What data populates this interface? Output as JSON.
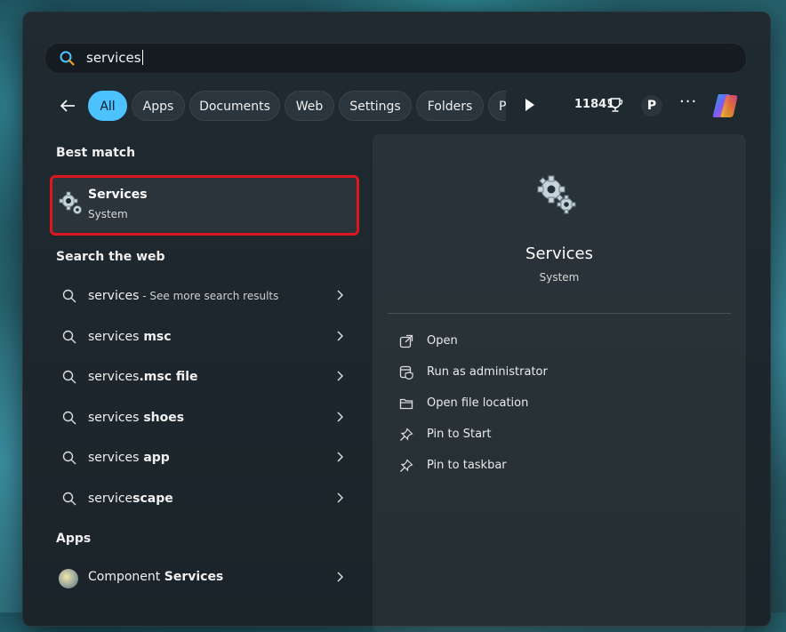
{
  "search": {
    "query": "services"
  },
  "filters": {
    "chips": [
      "All",
      "Apps",
      "Documents",
      "Web",
      "Settings",
      "Folders",
      "P"
    ],
    "points": "11841",
    "avatar_initial": "P",
    "more": "···"
  },
  "best_match": {
    "heading": "Best match",
    "title": "Services",
    "subtitle": "System"
  },
  "web": {
    "heading": "Search the web",
    "items": [
      {
        "prefix": "services",
        "suffix": "",
        "hint": " - See more search results"
      },
      {
        "prefix": "services",
        "suffix": " msc",
        "hint": ""
      },
      {
        "prefix": "services",
        "suffix": ".msc file",
        "hint": ""
      },
      {
        "prefix": "services",
        "suffix": " shoes",
        "hint": ""
      },
      {
        "prefix": "services",
        "suffix": " app",
        "hint": ""
      },
      {
        "prefix": "service",
        "suffix": "scape",
        "hint": ""
      }
    ]
  },
  "apps": {
    "heading": "Apps",
    "items": [
      {
        "prefix": "Component ",
        "bold": "Services"
      }
    ]
  },
  "preview": {
    "title": "Services",
    "subtitle": "System",
    "actions": [
      "Open",
      "Run as administrator",
      "Open file location",
      "Pin to Start",
      "Pin to taskbar"
    ]
  },
  "colors": {
    "accent": "#4cc2ff",
    "highlight_border": "#e0161f"
  }
}
